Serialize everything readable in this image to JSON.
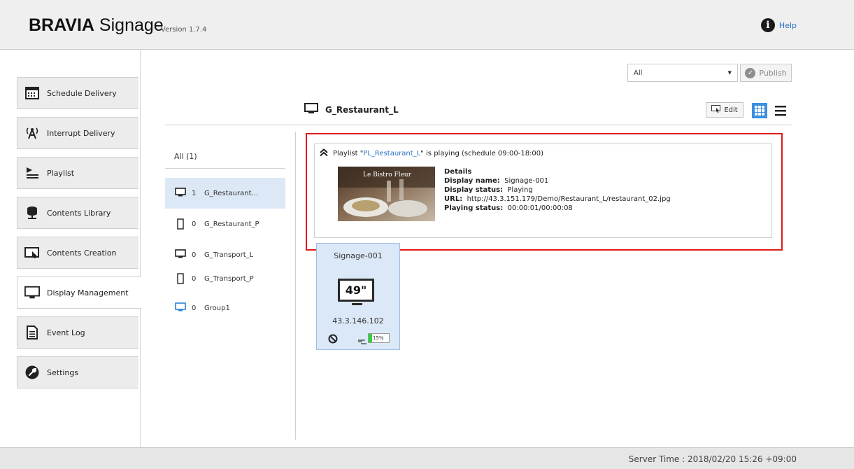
{
  "header": {
    "brand_bold": "BRAVIA",
    "brand_rest": " Signage",
    "version": "Version 1.7.4",
    "help_label": "Help"
  },
  "nav": {
    "items": [
      {
        "label": "Schedule Delivery",
        "icon": "calendar-icon"
      },
      {
        "label": "Interrupt Delivery",
        "icon": "broadcast-icon"
      },
      {
        "label": "Playlist",
        "icon": "playlist-icon"
      },
      {
        "label": "Contents Library",
        "icon": "database-icon"
      },
      {
        "label": "Contents Creation",
        "icon": "edit-window-icon"
      },
      {
        "label": "Display Management",
        "icon": "monitor-icon"
      },
      {
        "label": "Event Log",
        "icon": "document-icon"
      },
      {
        "label": "Settings",
        "icon": "wrench-icon"
      }
    ],
    "active": "Display Management"
  },
  "toolbar": {
    "filter_value": "All",
    "publish_label": "Publish"
  },
  "group_header": {
    "title": "G_Restaurant_L",
    "edit_label": "Edit"
  },
  "groups": {
    "all_label": "All (1)",
    "items": [
      {
        "count": "1",
        "name": "G_Restaurant…",
        "type": "landscape",
        "selected": true
      },
      {
        "count": "0",
        "name": "G_Restaurant_P",
        "type": "portrait"
      },
      {
        "count": "0",
        "name": "G_Transport_L",
        "type": "landscape"
      },
      {
        "count": "0",
        "name": "G_Transport_P",
        "type": "portrait"
      },
      {
        "count": "0",
        "name": "Group1",
        "type": "landscape-blue"
      }
    ]
  },
  "playing": {
    "prefix": "Playlist \"",
    "playlist_name": "PL_Restaurant_L",
    "suffix": "\" is playing (schedule 09:00-18:00)",
    "thumbnail_text": "Le Bistro Fleur",
    "details_title": "Details",
    "display_name_label": "Display name:",
    "display_name": "Signage-001",
    "display_status_label": "Display status:",
    "display_status": "Playing",
    "url_label": "URL:",
    "url": "http://43.3.151.179/Demo/Restaurant_L/restaurant_02.jpg",
    "playing_status_label": "Playing status:",
    "playing_status": "00:00:01/00:00:08"
  },
  "display_card": {
    "name": "Signage-001",
    "size": "49\"",
    "ip": "43.3.146.102",
    "network_percent": "15%"
  },
  "footer": {
    "server_time": "Server Time : 2018/02/20 15:26 +09:00"
  }
}
